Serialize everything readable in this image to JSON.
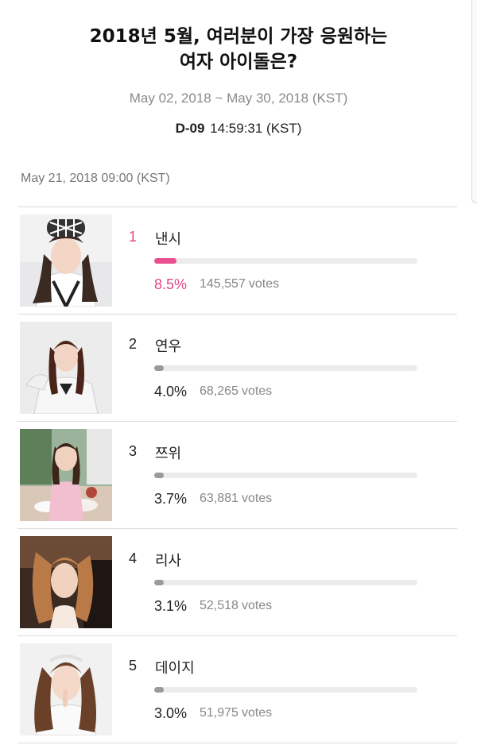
{
  "header": {
    "title_line1": "2018년 5월, 여러분이 가장 응원하는",
    "title_line2": "여자 아이돌은?",
    "period": "May 02, 2018 ~ May 30, 2018 (KST)",
    "countdown_dday": "D-09",
    "countdown_time": "14:59:31 (KST)"
  },
  "updated_at": "May 21, 2018 09:00 (KST)",
  "votes_label": "votes",
  "colors": {
    "accent": "#ea4f8f",
    "bar_default": "#9a9a9a",
    "bar_track": "#ececec"
  },
  "ranking": [
    {
      "rank": "1",
      "name": "낸시",
      "percent": "8.5%",
      "votes": "145,557",
      "share": 0.085,
      "photo": "idol-photo-nancy"
    },
    {
      "rank": "2",
      "name": "연우",
      "percent": "4.0%",
      "votes": "68,265",
      "share": 0.04,
      "photo": "idol-photo-yeonwoo"
    },
    {
      "rank": "3",
      "name": "쯔위",
      "percent": "3.7%",
      "votes": "63,881",
      "share": 0.037,
      "photo": "idol-photo-tzuyu"
    },
    {
      "rank": "4",
      "name": "리사",
      "percent": "3.1%",
      "votes": "52,518",
      "share": 0.031,
      "photo": "idol-photo-lisa"
    },
    {
      "rank": "5",
      "name": "데이지",
      "percent": "3.0%",
      "votes": "51,975",
      "share": 0.03,
      "photo": "idol-photo-daisy"
    }
  ]
}
